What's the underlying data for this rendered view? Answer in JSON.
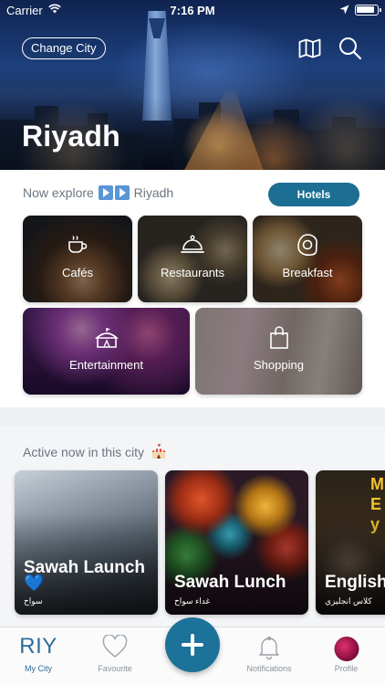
{
  "status_bar": {
    "carrier": "Carrier",
    "time": "7:16 PM"
  },
  "header": {
    "change_city_label": "Change City",
    "city_name": "Riyadh"
  },
  "explore": {
    "prefix": "Now explore",
    "city": "Riyadh",
    "hotels_label": "Hotels"
  },
  "categories": [
    {
      "label": "Cafés",
      "icon": "coffee-cup-icon"
    },
    {
      "label": "Restaurants",
      "icon": "cloche-icon"
    },
    {
      "label": "Breakfast",
      "icon": "fried-egg-icon"
    },
    {
      "label": "Entertainment",
      "icon": "circus-tent-icon"
    },
    {
      "label": "Shopping",
      "icon": "shopping-bag-icon"
    }
  ],
  "active": {
    "heading": "Active now in this city",
    "cards": [
      {
        "title": "Sawah Launch",
        "emoji": "💙",
        "subtitle": "سواح"
      },
      {
        "title": "Sawah Lunch",
        "subtitle": "غداء سواح"
      },
      {
        "title": "English",
        "subtitle": "كلاس انجليزي"
      }
    ]
  },
  "tab_bar": {
    "logo_text": "RIY",
    "items": [
      {
        "label": "My City"
      },
      {
        "label": "Favourite"
      },
      {
        "label": "Notifications"
      },
      {
        "label": "Profile"
      }
    ]
  },
  "colors": {
    "accent": "#1d7299",
    "logo": "#2f6b97"
  }
}
